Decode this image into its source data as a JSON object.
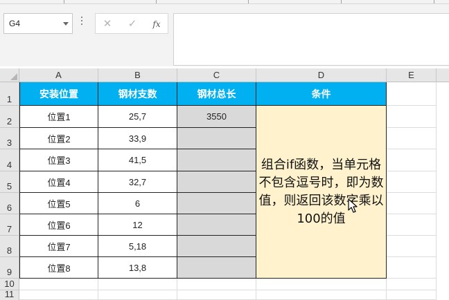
{
  "name_box": {
    "value": "G4"
  },
  "formula_bar": {
    "cancel_symbol": "✕",
    "enter_symbol": "✓",
    "function_symbol": "fx",
    "content": ""
  },
  "columns": [
    "A",
    "B",
    "C",
    "D",
    "E"
  ],
  "rows": [
    "1",
    "2",
    "3",
    "4",
    "5",
    "6",
    "7",
    "8",
    "9",
    "10",
    "11"
  ],
  "table": {
    "headers": [
      "安装位置",
      "钢材支数",
      "钢材总长",
      "条件"
    ],
    "rows": [
      {
        "position": "位置1",
        "count": "25,7",
        "total": "3550"
      },
      {
        "position": "位置2",
        "count": "33,9",
        "total": ""
      },
      {
        "position": "位置3",
        "count": "41,5",
        "total": ""
      },
      {
        "position": "位置4",
        "count": "32,7",
        "total": ""
      },
      {
        "position": "位置5",
        "count": "6",
        "total": ""
      },
      {
        "position": "位置6",
        "count": "12",
        "total": ""
      },
      {
        "position": "位置7",
        "count": "5,18",
        "total": ""
      },
      {
        "position": "位置8",
        "count": "13,8",
        "total": ""
      }
    ],
    "condition_text": "组合if函数，当单元格不包含逗号时，即为数值，则返回该数字乘以100的值"
  },
  "colors": {
    "header_fill": "#00b0f0",
    "condition_fill": "#fff2cc",
    "total_fill": "#d9d9d9"
  }
}
